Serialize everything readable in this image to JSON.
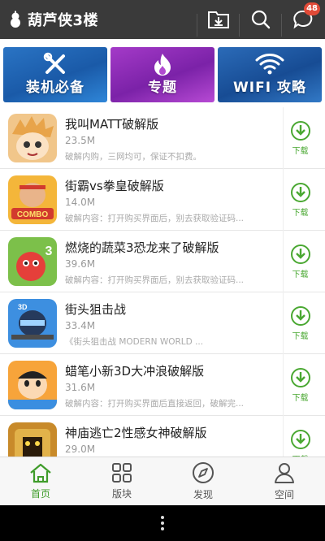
{
  "header": {
    "title": "葫芦侠3楼",
    "notification_count": "48"
  },
  "banners": [
    {
      "label": "装机必备"
    },
    {
      "label": "专题"
    },
    {
      "label": "WIFI 攻略"
    }
  ],
  "apps": [
    {
      "name": "我叫MATT破解版",
      "size": "23.5M",
      "desc": "破解内购，三网均可，保证不扣费。",
      "download_label": "下载"
    },
    {
      "name": "街霸vs拳皇破解版",
      "size": "14.0M",
      "desc": "破解内容：打开购买界面后，别去获取验证码...",
      "download_label": "下载"
    },
    {
      "name": "燃烧的蔬菜3恐龙来了破解版",
      "size": "39.6M",
      "desc": "破解内容：打开购买界面后，别去获取验证码...",
      "download_label": "下载"
    },
    {
      "name": "街头狙击战",
      "size": "33.4M",
      "desc": "《街头狙击战 MODERN WORLD ...",
      "download_label": "下载"
    },
    {
      "name": "蜡笔小新3D大冲浪破解版",
      "size": "31.6M",
      "desc": "破解内容：打开购买界面后直接返回，破解完...",
      "download_label": "下载"
    },
    {
      "name": "神庙逃亡2性感女神破解版",
      "size": "29.0M",
      "desc": "",
      "download_label": "下载"
    }
  ],
  "bottom_nav": [
    {
      "label": "首页",
      "icon": "home-icon",
      "active": true
    },
    {
      "label": "版块",
      "icon": "grid-icon",
      "active": false
    },
    {
      "label": "发现",
      "icon": "compass-icon",
      "active": false
    },
    {
      "label": "空间",
      "icon": "person-icon",
      "active": false
    }
  ],
  "colors": {
    "header_bg": "#3a3a3a",
    "accent_green": "#4aa832",
    "badge_red": "#e14a37"
  }
}
